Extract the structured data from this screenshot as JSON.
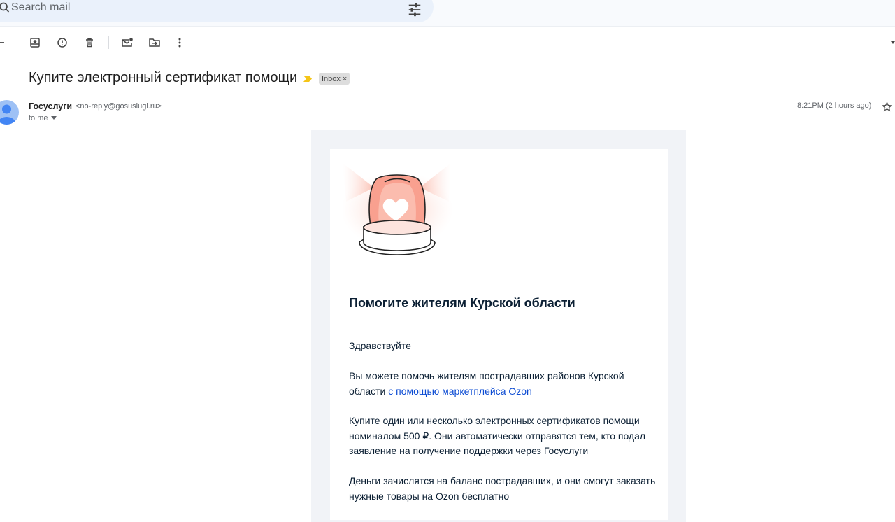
{
  "search": {
    "placeholder": "Search mail"
  },
  "email": {
    "subject": "Купите электронный сертификат помощи",
    "label": "Inbox",
    "label_close": "×",
    "sender_name": "Госуслуги",
    "sender_email": "<no-reply@gosuslugi.ru>",
    "recipient": "to me",
    "time": "8:21PM (2 hours ago)"
  },
  "body": {
    "heading": "Помогите жителям Курской области",
    "greeting": "Здравствуйте",
    "p1_text": "Вы можете помочь жителям пострадавших районов Курской области ",
    "p1_link": "с помощью маркетплейса Ozon",
    "p2": "Купите один или несколько электронных сертификатов помощи номиналом 500 ₽. Они автоматически отправятся тем, кто подал заявление на получение поддержки через Госуслуги",
    "p3": "Деньги зачислятся на баланс пострадавших, и они смогут заказать нужные товары на Ozon бесплатно"
  },
  "colors": {
    "link": "#0d4cd3",
    "accent_siren": "#f9a08f",
    "important": "#f5c518"
  }
}
